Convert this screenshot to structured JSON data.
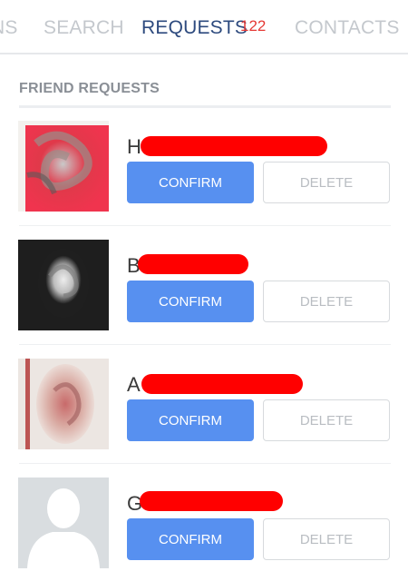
{
  "tabs": [
    {
      "label": "NS",
      "active": false
    },
    {
      "label": "SEARCH",
      "active": false
    },
    {
      "label": "REQUESTS",
      "active": true,
      "count": "122"
    },
    {
      "label": "CONTACTS",
      "active": false
    }
  ],
  "section": {
    "title": "FRIEND REQUESTS"
  },
  "requests": [
    {
      "name_visible": "H",
      "avatar": "photo-red-shirt",
      "confirm_label": "CONFIRM",
      "delete_label": "DELETE"
    },
    {
      "name_visible": "B",
      "avatar": "photo-dark",
      "confirm_label": "CONFIRM",
      "delete_label": "DELETE"
    },
    {
      "name_visible": "A",
      "avatar": "photo-light",
      "confirm_label": "CONFIRM",
      "delete_label": "DELETE"
    },
    {
      "name_visible": "G",
      "avatar": "default-silhouette",
      "confirm_label": "CONFIRM",
      "delete_label": "DELETE"
    }
  ],
  "colors": {
    "active_tab": "#2d4a7e",
    "inactive_tab": "#c4c8cd",
    "count_badge": "#e53935",
    "confirm_bg": "#5790f0",
    "delete_text": "#b9bdc2",
    "redaction": "#ff0000"
  }
}
